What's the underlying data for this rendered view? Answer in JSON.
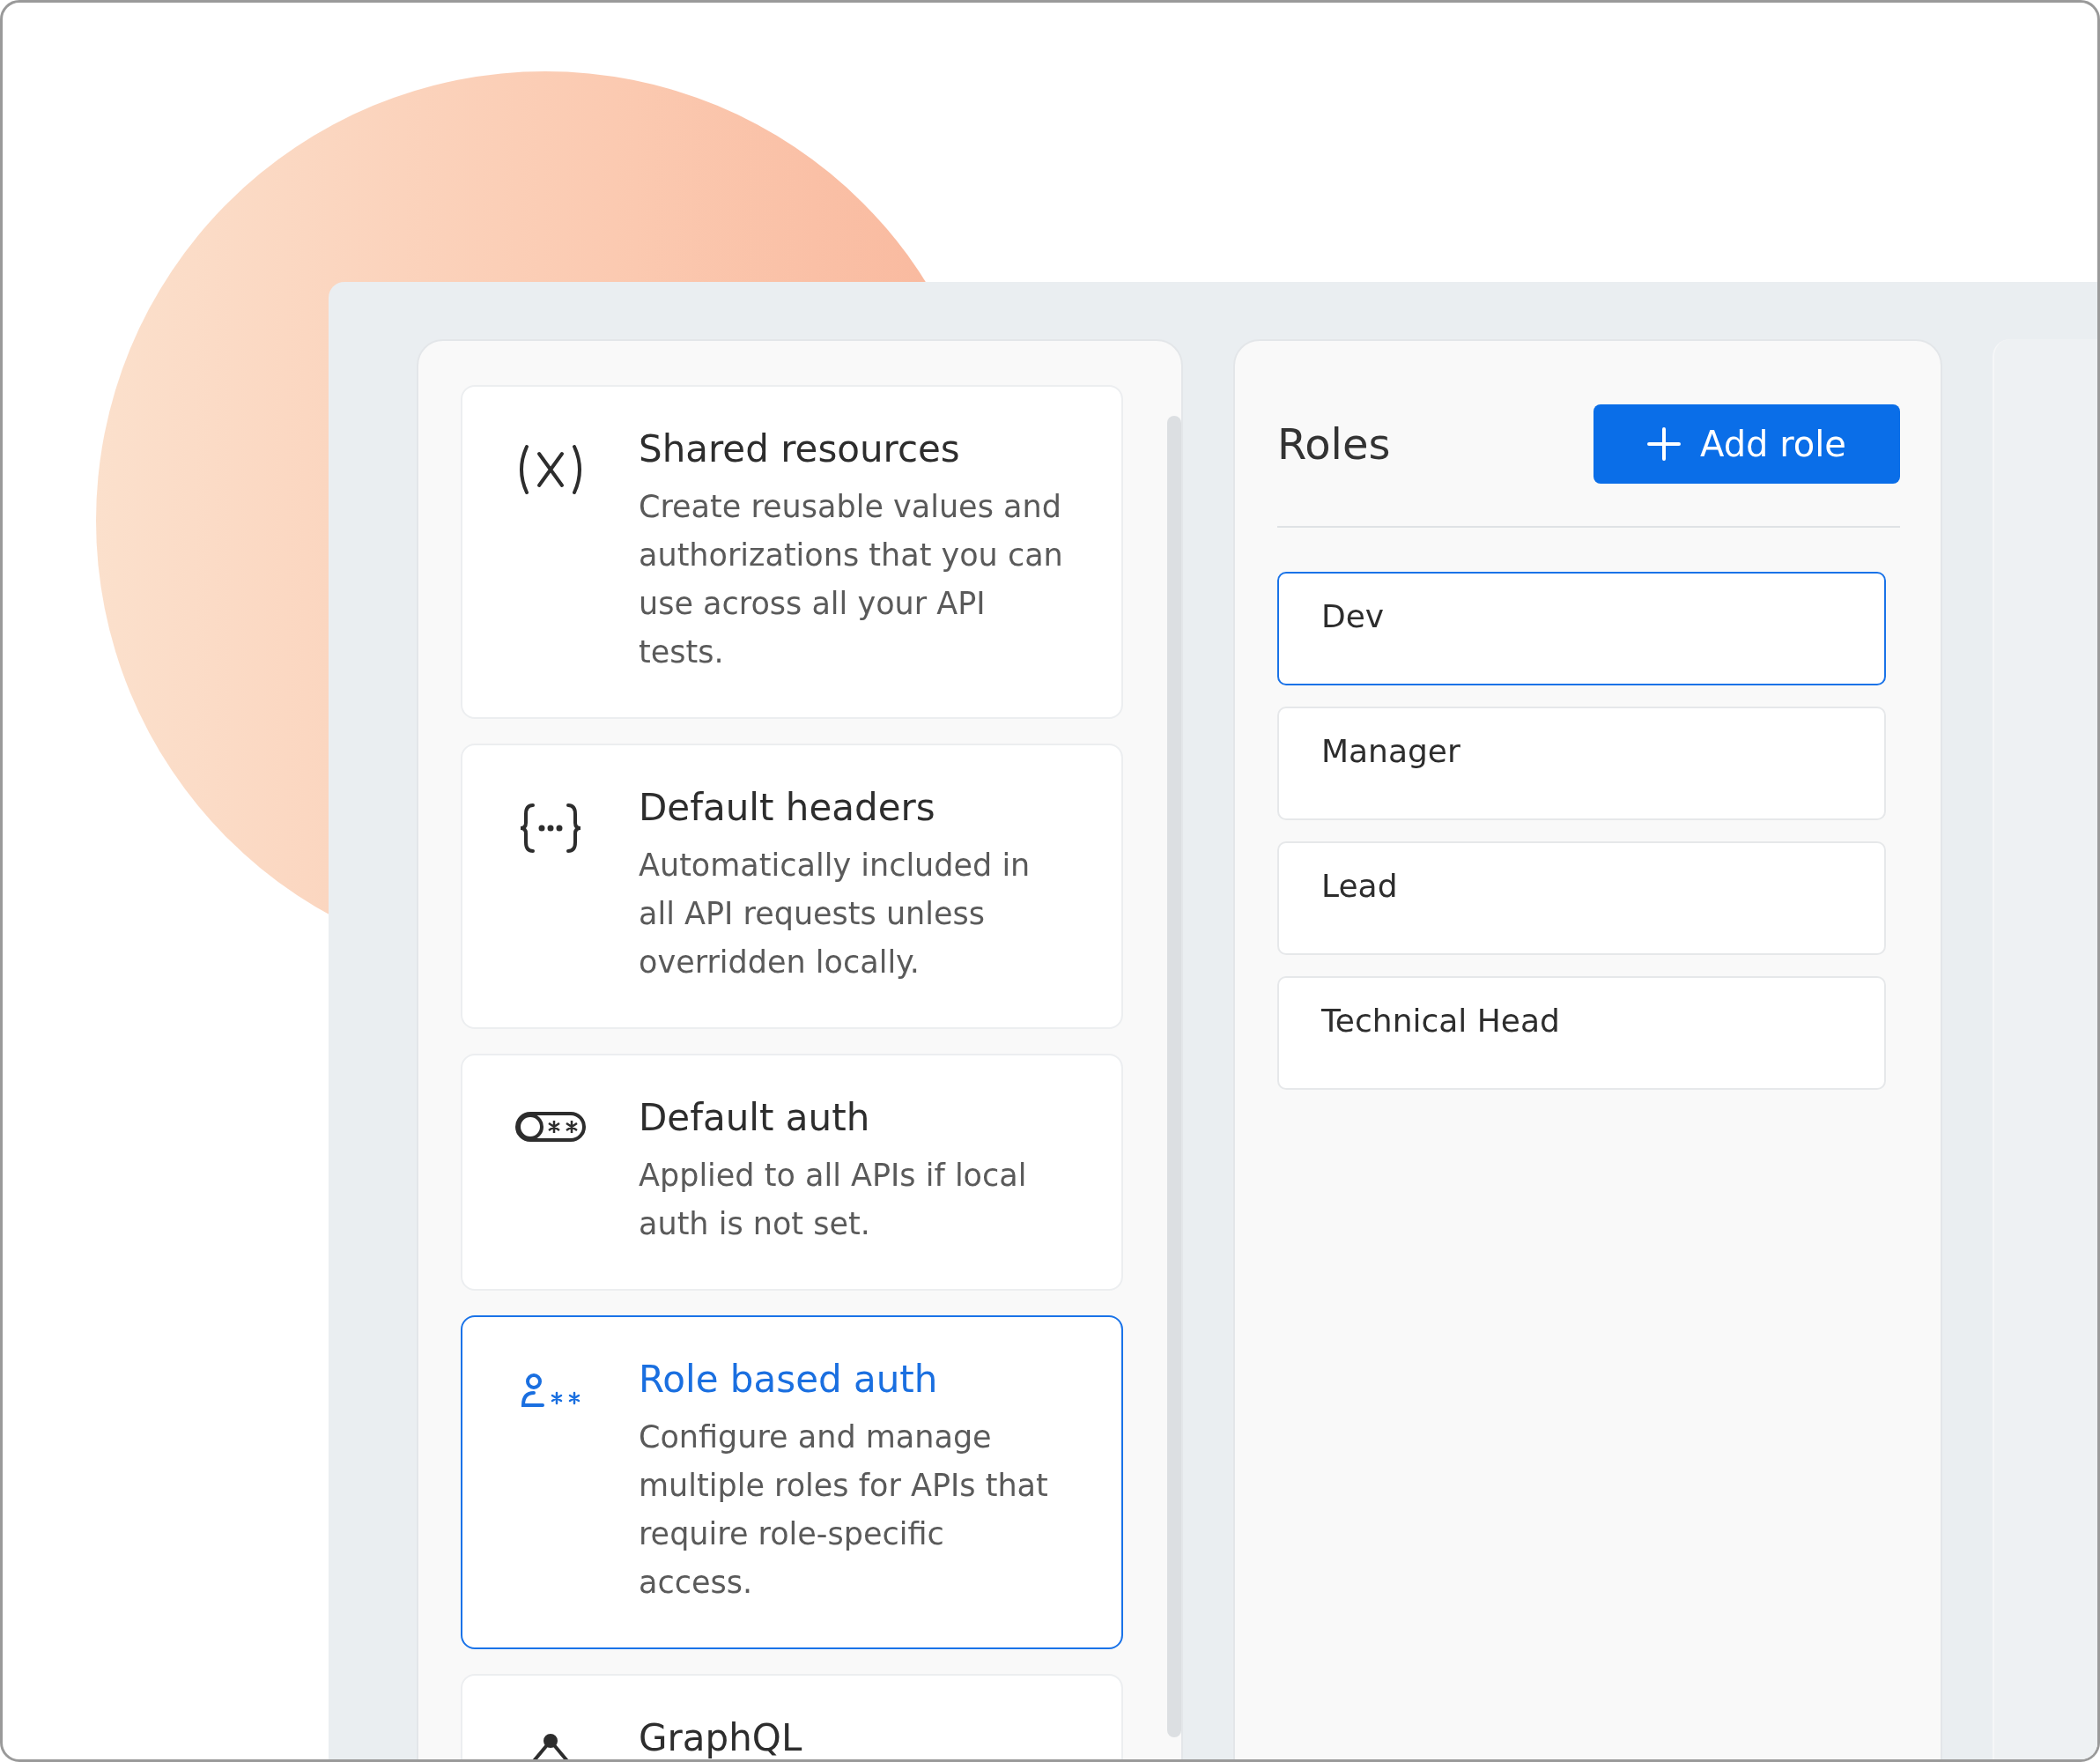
{
  "features": [
    {
      "kind": "variable",
      "title": "Shared resources",
      "description": "Create reusable values and authorizations that you can use across all your API tests.",
      "selected": false
    },
    {
      "kind": "braces",
      "title": "Default headers",
      "description": "Automatically included in all API requests unless overridden locally.",
      "selected": false
    },
    {
      "kind": "toggle",
      "title": "Default auth",
      "description": "Applied to all APIs if local auth is not set.",
      "selected": false
    },
    {
      "kind": "user-key",
      "title": "Role based auth",
      "description": "Configure and manage multiple roles for APIs that require role-specific access.",
      "selected": true
    },
    {
      "kind": "graph",
      "title": "GraphQL",
      "selected": false
    }
  ],
  "roles_panel": {
    "title": "Roles",
    "add_button": "Add role"
  },
  "roles": [
    {
      "name": "Dev",
      "selected": true
    },
    {
      "name": "Manager",
      "selected": false
    },
    {
      "name": "Lead",
      "selected": false
    },
    {
      "name": "Technical Head",
      "selected": false
    }
  ]
}
